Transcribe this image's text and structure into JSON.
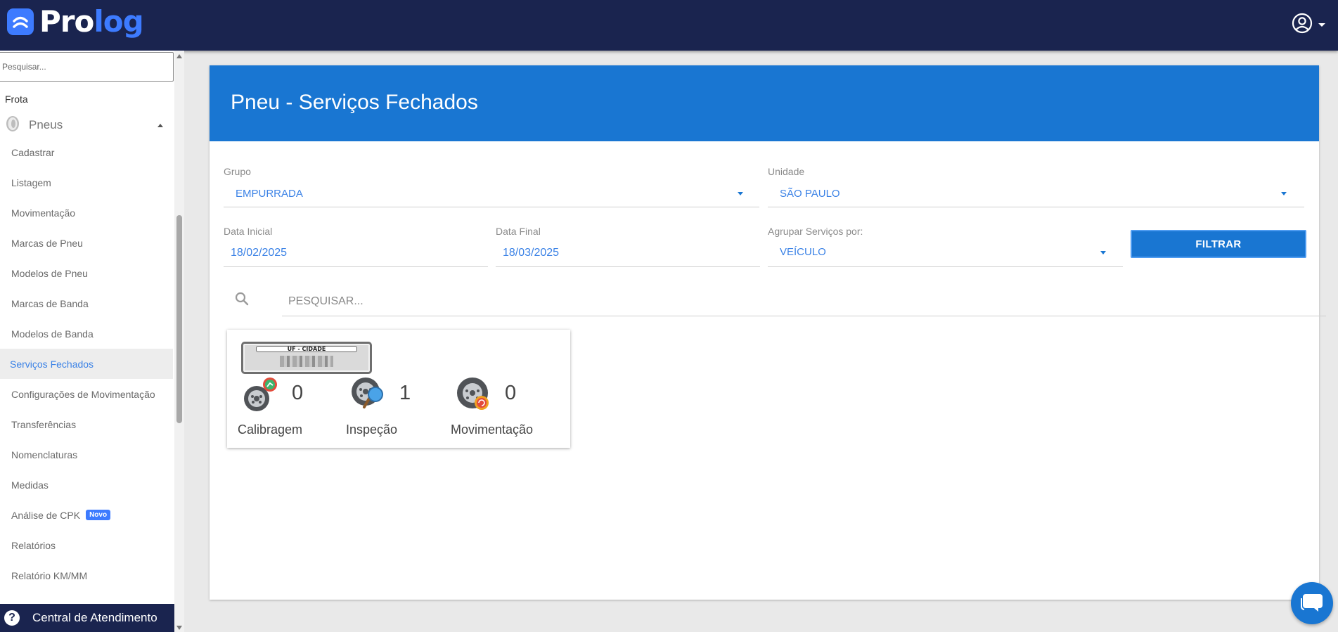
{
  "app": {
    "logo_part1": "Pro",
    "logo_part2": "log",
    "brand_color": "#1a244f",
    "accent_color": "#1976d2"
  },
  "header": {
    "user_icon": "user-circle-icon",
    "menu_icon": "caret-down-icon"
  },
  "sidebar": {
    "search_placeholder": "Pesquisar...",
    "section": "Frota",
    "group": {
      "label": "Pneus",
      "icon": "tire-icon"
    },
    "items": [
      {
        "label": "Cadastrar"
      },
      {
        "label": "Listagem"
      },
      {
        "label": "Movimentação"
      },
      {
        "label": "Marcas de Pneu"
      },
      {
        "label": "Modelos de Pneu"
      },
      {
        "label": "Marcas de Banda"
      },
      {
        "label": "Modelos de Banda"
      },
      {
        "label": "Serviços Fechados",
        "active": true
      },
      {
        "label": "Configurações de Movimentação"
      },
      {
        "label": "Transferências"
      },
      {
        "label": "Nomenclaturas"
      },
      {
        "label": "Medidas"
      },
      {
        "label": "Análise de CPK",
        "badge": "Novo"
      },
      {
        "label": "Relatórios"
      },
      {
        "label": "Relatório KM/MM"
      }
    ],
    "help": {
      "label": "Central de Atendimento",
      "icon": "question-circle-icon"
    }
  },
  "page": {
    "title": "Pneu - Serviços Fechados"
  },
  "filters": {
    "grupo": {
      "label": "Grupo",
      "value": "EMPURRADA"
    },
    "unidade": {
      "label": "Unidade",
      "value": "SÃO PAULO"
    },
    "data_inicial": {
      "label": "Data Inicial",
      "value": "18/02/2025"
    },
    "data_final": {
      "label": "Data Final",
      "value": "18/03/2025"
    },
    "agrupar": {
      "label": "Agrupar Serviços por:",
      "value": "VEÍCULO"
    },
    "filtrar_button": "FILTRAR"
  },
  "search": {
    "placeholder": "PESQUISAR...",
    "icon": "search-icon"
  },
  "vehicle_card": {
    "plate_header": "UF - CIDADE",
    "services": [
      {
        "label": "Calibragem",
        "count": "0",
        "icon": "tire-calibration-icon"
      },
      {
        "label": "Inspeção",
        "count": "1",
        "icon": "tire-inspection-icon"
      },
      {
        "label": "Movimentação",
        "count": "0",
        "icon": "tire-movement-icon"
      }
    ]
  },
  "chat": {
    "icon": "chat-bubble-icon"
  }
}
